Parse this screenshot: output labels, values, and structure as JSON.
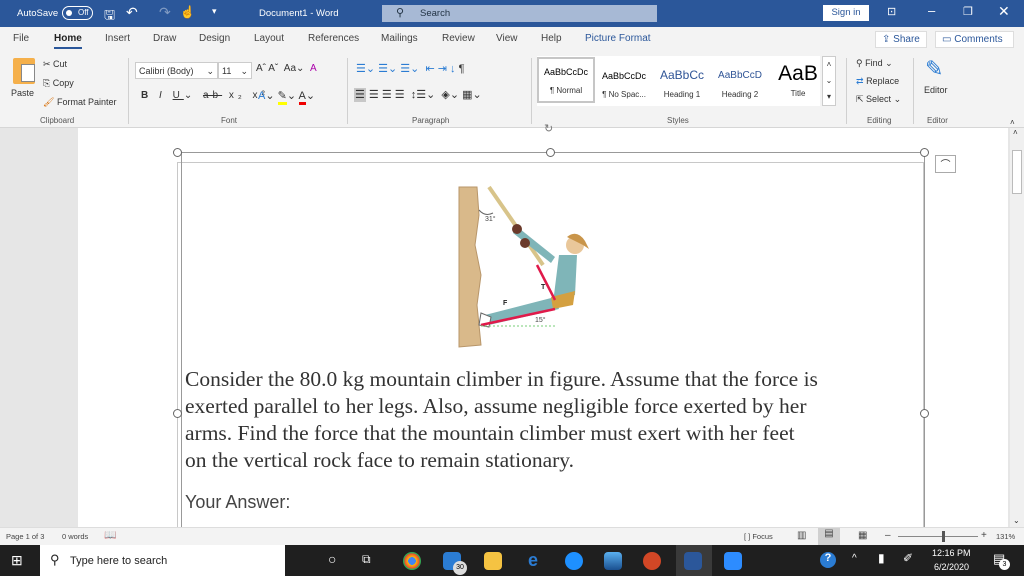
{
  "titlebar": {
    "autosave": "AutoSave",
    "autosave_state": "Off",
    "doc_title": "Document1  -  Word",
    "search_placeholder": "Search",
    "sign_in": "Sign in"
  },
  "tabs": [
    {
      "label": "File"
    },
    {
      "label": "Home",
      "active": true
    },
    {
      "label": "Insert"
    },
    {
      "label": "Draw"
    },
    {
      "label": "Design"
    },
    {
      "label": "Layout"
    },
    {
      "label": "References"
    },
    {
      "label": "Mailings"
    },
    {
      "label": "Review"
    },
    {
      "label": "View"
    },
    {
      "label": "Help"
    },
    {
      "label": "Picture Format"
    }
  ],
  "share": "Share",
  "comments": "Comments",
  "clipboard": {
    "paste": "Paste",
    "cut": "Cut",
    "copy": "Copy",
    "format_painter": "Format Painter",
    "label": "Clipboard"
  },
  "font": {
    "name": "Calibri (Body)",
    "size": "11",
    "label": "Font"
  },
  "paragraph": {
    "label": "Paragraph"
  },
  "styles": {
    "items": [
      {
        "preview": "AaBbCcDc",
        "name": "¶ Normal"
      },
      {
        "preview": "AaBbCcDc",
        "name": "¶ No Spac..."
      },
      {
        "preview": "AaBbCc",
        "name": "Heading 1"
      },
      {
        "preview": "AaBbCcD",
        "name": "Heading 2"
      },
      {
        "preview": "AaB",
        "name": "Title"
      }
    ],
    "label": "Styles"
  },
  "editing": {
    "find": "Find",
    "replace": "Replace",
    "select": "Select",
    "label": "Editing"
  },
  "editor": {
    "button": "Editor",
    "label": "Editor"
  },
  "figure": {
    "angle_top": "31°",
    "tension": "T",
    "force": "F",
    "angle_bottom": "15°"
  },
  "document": {
    "question": "Consider the 80.0 kg mountain climber in figure. Assume that the force is exerted parallel to her legs. Also, assume negligible force exerted by her arms. Find the force that the mountain climber must exert with her feet on the vertical rock face to remain stationary.",
    "lines": [
      "Consider the 80.0 kg mountain climber in figure. Assume that the force is",
      "exerted parallel to her legs. Also, assume negligible force exerted by her",
      "arms. Find the force that the mountain climber must exert with her feet",
      "on the vertical rock face to remain stationary."
    ],
    "answer_label": "Your Answer:"
  },
  "status": {
    "page": "Page 1 of 3",
    "words": "0 words",
    "focus": "Focus",
    "zoom": "131%",
    "zoom_fraction": 0.55
  },
  "taskbar": {
    "search_placeholder": "Type here to search",
    "mail_badge": "30",
    "time": "12:16 PM",
    "date": "6/2/2020",
    "notif_count": "3"
  },
  "colors": {
    "title_blue": "#2b579a",
    "accent": "#2b579a"
  }
}
